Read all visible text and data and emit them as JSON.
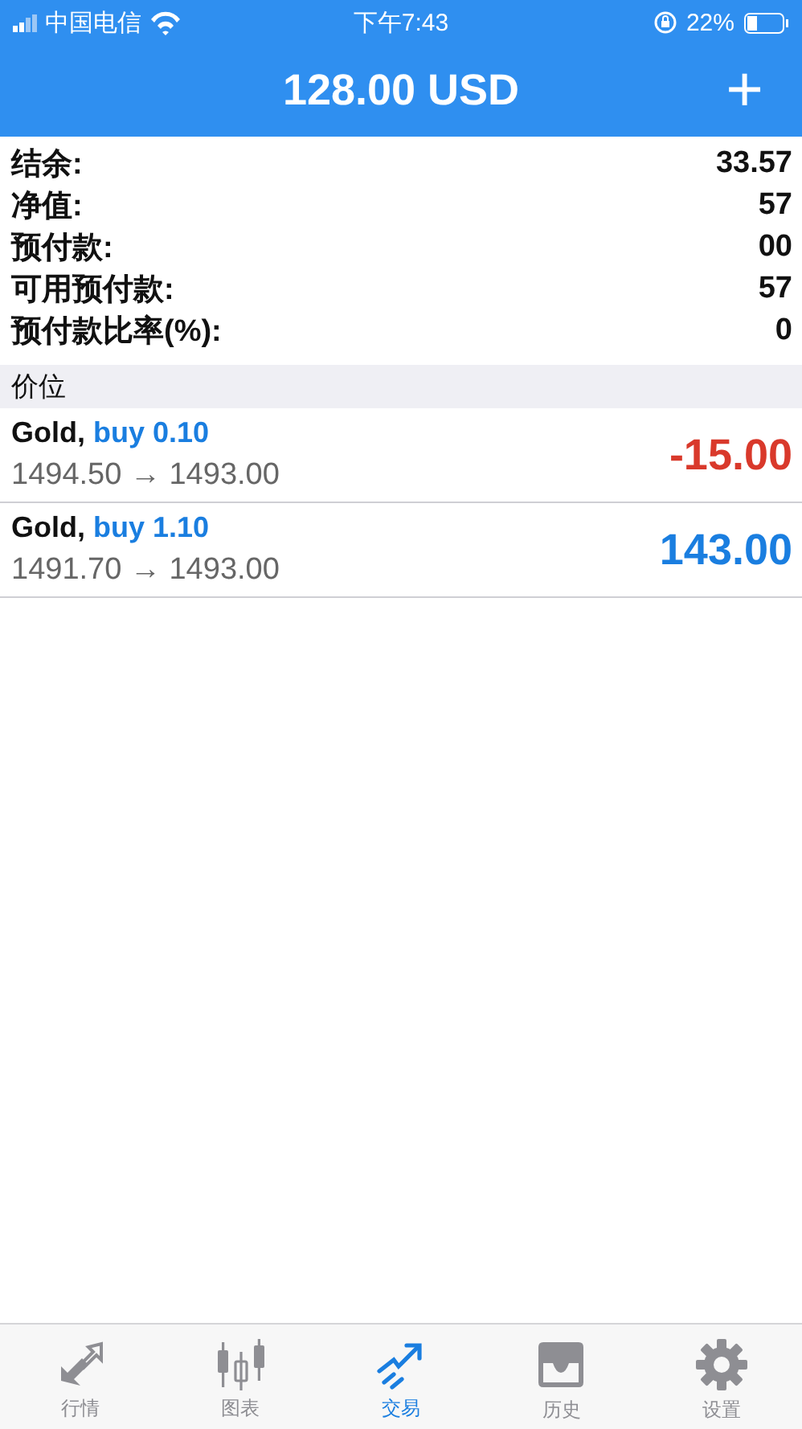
{
  "status_bar": {
    "carrier": "中国电信",
    "time": "下午7:43",
    "battery": "22%"
  },
  "header": {
    "title": "128.00 USD",
    "add_button": "+"
  },
  "account": [
    {
      "label": "结余:",
      "value": "33.57"
    },
    {
      "label": "净值:",
      "value": "57"
    },
    {
      "label": "预付款:",
      "value": "00"
    },
    {
      "label": "可用预付款:",
      "value": "57"
    },
    {
      "label": "预付款比率(%):",
      "value": "0"
    }
  ],
  "section_header": "价位",
  "positions": [
    {
      "symbol": "Gold,",
      "side": "buy 0.10",
      "prices": "1494.50 → 1493.00",
      "profit": "-15.00",
      "color": "#d9392b"
    },
    {
      "symbol": "Gold,",
      "side": "buy 1.10",
      "prices": "1491.70 → 1493.00",
      "profit": "143.00",
      "color": "#1a7ee0"
    }
  ],
  "tabs": [
    {
      "label": "行情",
      "kind": "quotes",
      "selected": false
    },
    {
      "label": "图表",
      "kind": "charts",
      "selected": false
    },
    {
      "label": "交易",
      "kind": "trade",
      "selected": true
    },
    {
      "label": "历史",
      "kind": "history",
      "selected": false
    },
    {
      "label": "设置",
      "kind": "settings",
      "selected": false
    }
  ]
}
